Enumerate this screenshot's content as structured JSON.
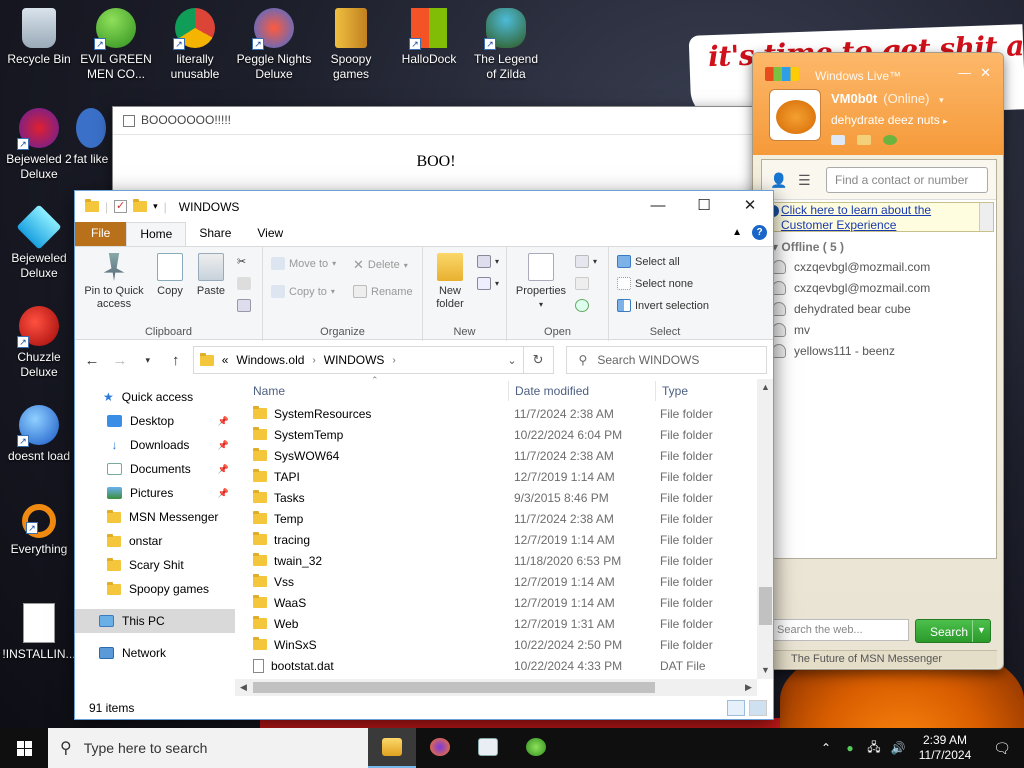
{
  "desktop": {
    "icons": [
      {
        "label": "Recycle Bin"
      },
      {
        "label": "EVIL GREEN MEN CO..."
      },
      {
        "label": "literally unusable"
      },
      {
        "label": "Peggle Nights Deluxe"
      },
      {
        "label": "Spoopy games"
      },
      {
        "label": "HalloDock"
      },
      {
        "label": "The Legend of Zilda"
      },
      {
        "label": "Bejeweled 2 Deluxe"
      },
      {
        "label": "fat like"
      },
      {
        "label": "Bejeweled Deluxe"
      },
      {
        "label": "Chuzzle Deluxe"
      },
      {
        "label": "doesnt load"
      },
      {
        "label": "Everything"
      },
      {
        "label": "!INSTALLIN..."
      }
    ],
    "wallpaper_text": "it's time to get shit and"
  },
  "boo_window": {
    "title": "BOOOOOOO!!!!!",
    "message": "BOO!"
  },
  "msn": {
    "brand": "Windows Live™",
    "user_name": "VM0b0t",
    "status": "(Online)",
    "personal_message": "dehydrate deez nuts",
    "find_placeholder": "Find a contact or number",
    "ad_text": "Click here to learn about the Customer Experience",
    "group_label": "Offline ( 5 )",
    "contacts": [
      {
        "name": "cxzqevbgl@mozmail.com"
      },
      {
        "name": "cxzqevbgl@mozmail.com"
      },
      {
        "name": "dehydrated bear cube"
      },
      {
        "name": "mv"
      },
      {
        "name": "yellows111 - beenz"
      }
    ],
    "web_search_placeholder": "Search the web...",
    "search_button": "Search",
    "footer": "The Future of MSN Messenger"
  },
  "explorer": {
    "title": "WINDOWS",
    "tabs": {
      "file": "File",
      "home": "Home",
      "share": "Share",
      "view": "View"
    },
    "ribbon": {
      "pin": "Pin to Quick access",
      "copy": "Copy",
      "paste": "Paste",
      "clipboard": "Clipboard",
      "move_to": "Move to",
      "copy_to": "Copy to",
      "delete": "Delete",
      "rename": "Rename",
      "organize": "Organize",
      "new_folder": "New folder",
      "new": "New",
      "properties": "Properties",
      "open": "Open",
      "select_all": "Select all",
      "select_none": "Select none",
      "invert_selection": "Invert selection",
      "select": "Select"
    },
    "address": {
      "prefix": "«",
      "parts": [
        "Windows.old",
        "WINDOWS"
      ]
    },
    "search_placeholder": "Search WINDOWS",
    "nav": {
      "quick_access": "Quick access",
      "items": [
        {
          "label": "Desktop"
        },
        {
          "label": "Downloads"
        },
        {
          "label": "Documents"
        },
        {
          "label": "Pictures"
        },
        {
          "label": "MSN Messenger"
        },
        {
          "label": "onstar"
        },
        {
          "label": "Scary Shit"
        },
        {
          "label": "Spoopy games"
        }
      ],
      "this_pc": "This PC",
      "network": "Network"
    },
    "columns": {
      "name": "Name",
      "date": "Date modified",
      "type": "Type"
    },
    "files": [
      {
        "name": "SystemResources",
        "date": "11/7/2024 2:38 AM",
        "type": "File folder"
      },
      {
        "name": "SystemTemp",
        "date": "10/22/2024 6:04 PM",
        "type": "File folder"
      },
      {
        "name": "SysWOW64",
        "date": "11/7/2024 2:38 AM",
        "type": "File folder"
      },
      {
        "name": "TAPI",
        "date": "12/7/2019 1:14 AM",
        "type": "File folder"
      },
      {
        "name": "Tasks",
        "date": "9/3/2015 8:46 PM",
        "type": "File folder"
      },
      {
        "name": "Temp",
        "date": "11/7/2024 2:38 AM",
        "type": "File folder"
      },
      {
        "name": "tracing",
        "date": "12/7/2019 1:14 AM",
        "type": "File folder"
      },
      {
        "name": "twain_32",
        "date": "11/18/2020 6:53 PM",
        "type": "File folder"
      },
      {
        "name": "Vss",
        "date": "12/7/2019 1:14 AM",
        "type": "File folder"
      },
      {
        "name": "WaaS",
        "date": "12/7/2019 1:14 AM",
        "type": "File folder"
      },
      {
        "name": "Web",
        "date": "12/7/2019 1:31 AM",
        "type": "File folder"
      },
      {
        "name": "WinSxS",
        "date": "10/22/2024 2:50 PM",
        "type": "File folder"
      },
      {
        "name": "bootstat.dat",
        "date": "10/22/2024 4:33 PM",
        "type": "DAT File"
      }
    ],
    "status": "91 items"
  },
  "taskbar": {
    "search_placeholder": "Type here to search",
    "time": "2:39 AM",
    "date": "11/7/2024"
  }
}
